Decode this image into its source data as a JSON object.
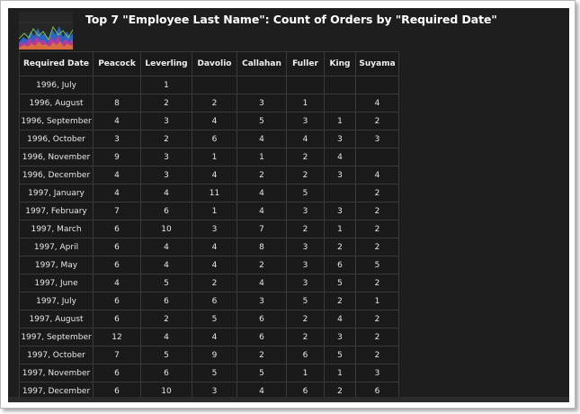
{
  "title": "Top 7 \"Employee Last Name\": Count of Orders by \"Required Date\"",
  "logo_icon": "sparkline-area-chart-icon",
  "colors": {
    "background": "#1e1e1e",
    "text": "#e6e6e6",
    "grid_line": "#3a3a3a"
  },
  "table": {
    "columns": [
      "Required Date",
      "Peacock",
      "Leverling",
      "Davolio",
      "Callahan",
      "Fuller",
      "King",
      "Suyama"
    ],
    "rows": [
      [
        "1996, July",
        "",
        "1",
        "",
        "",
        "",
        "",
        ""
      ],
      [
        "1996, August",
        "8",
        "2",
        "2",
        "3",
        "1",
        "",
        "4"
      ],
      [
        "1996, September",
        "4",
        "3",
        "4",
        "5",
        "3",
        "1",
        "2"
      ],
      [
        "1996, October",
        "3",
        "2",
        "6",
        "4",
        "4",
        "3",
        "3"
      ],
      [
        "1996, November",
        "9",
        "3",
        "1",
        "1",
        "2",
        "4",
        ""
      ],
      [
        "1996, December",
        "4",
        "3",
        "4",
        "2",
        "2",
        "3",
        "4"
      ],
      [
        "1997, January",
        "4",
        "4",
        "11",
        "4",
        "5",
        "",
        "2"
      ],
      [
        "1997, February",
        "7",
        "6",
        "1",
        "4",
        "3",
        "3",
        "2"
      ],
      [
        "1997, March",
        "6",
        "10",
        "3",
        "7",
        "2",
        "1",
        "2"
      ],
      [
        "1997, April",
        "6",
        "4",
        "4",
        "8",
        "3",
        "2",
        "2"
      ],
      [
        "1997, May",
        "6",
        "4",
        "4",
        "2",
        "3",
        "6",
        "5"
      ],
      [
        "1997, June",
        "4",
        "5",
        "2",
        "4",
        "3",
        "5",
        "2"
      ],
      [
        "1997, July",
        "6",
        "6",
        "6",
        "3",
        "5",
        "2",
        "1"
      ],
      [
        "1997, August",
        "6",
        "2",
        "5",
        "6",
        "2",
        "4",
        "2"
      ],
      [
        "1997, September",
        "12",
        "4",
        "4",
        "6",
        "2",
        "3",
        "2"
      ],
      [
        "1997, October",
        "7",
        "5",
        "9",
        "2",
        "6",
        "5",
        "2"
      ],
      [
        "1997, November",
        "6",
        "6",
        "5",
        "5",
        "1",
        "1",
        "3"
      ],
      [
        "1997, December",
        "6",
        "10",
        "3",
        "4",
        "6",
        "2",
        "6"
      ]
    ]
  }
}
